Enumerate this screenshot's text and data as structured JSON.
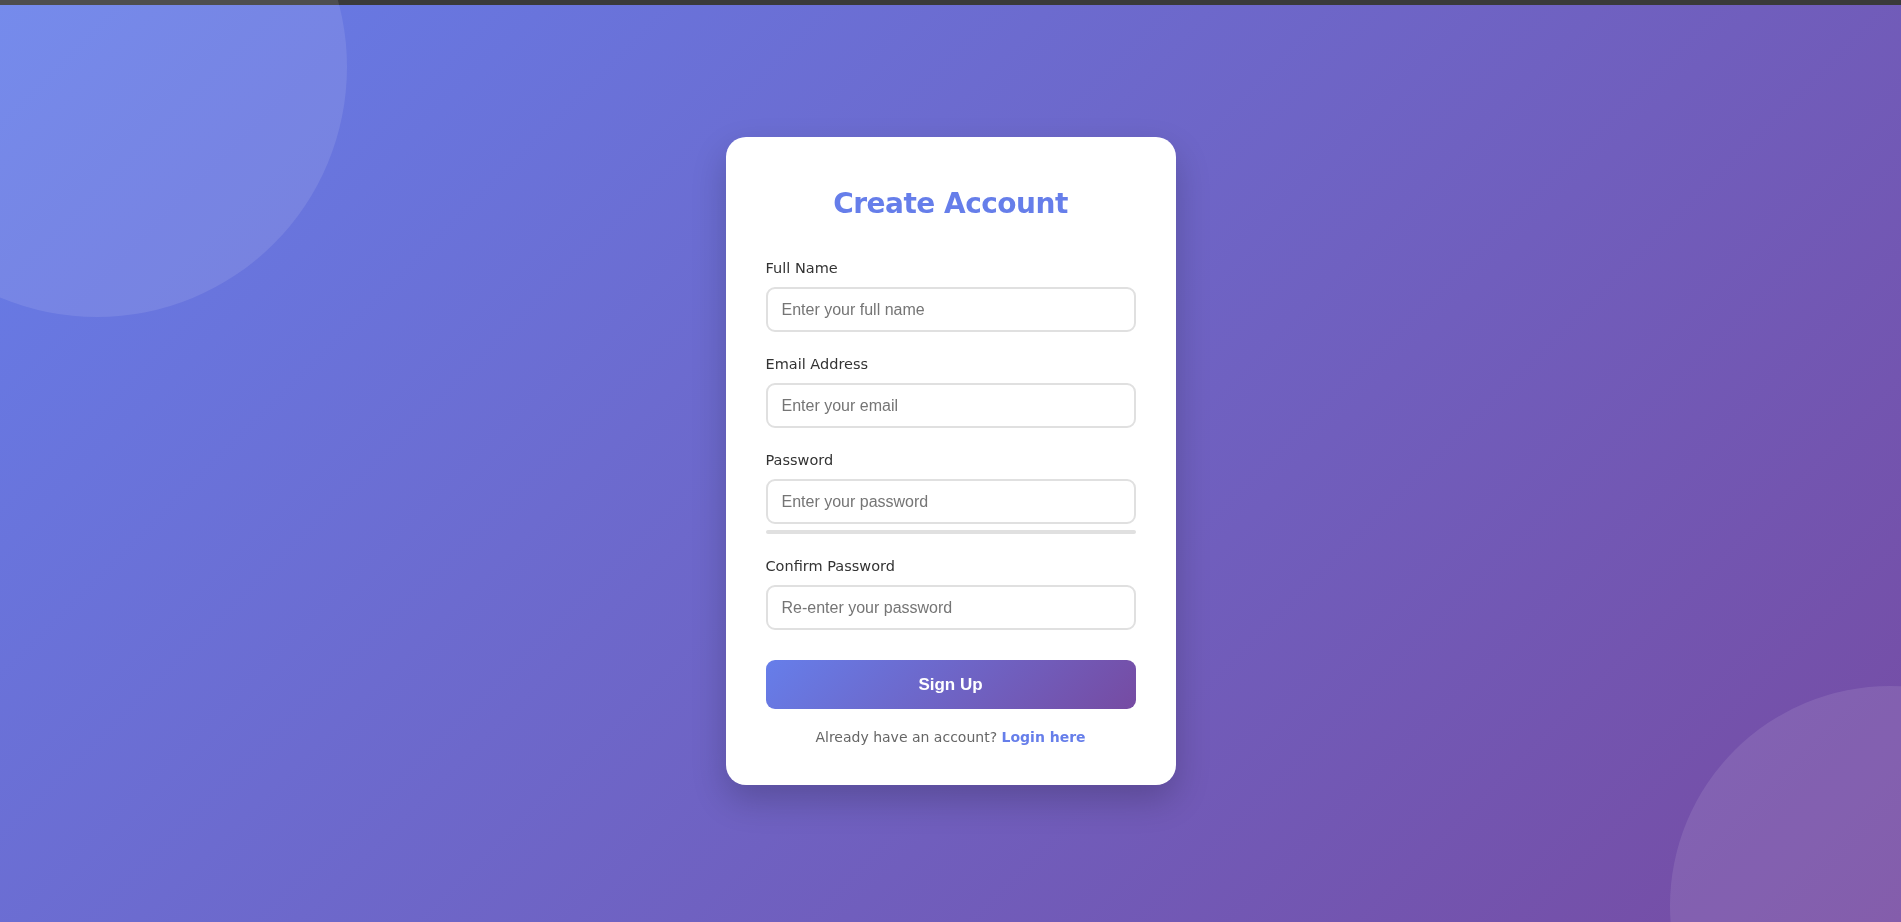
{
  "card": {
    "title": "Create Account",
    "fields": [
      {
        "label": "Full Name",
        "placeholder": "Enter your full name"
      },
      {
        "label": "Email Address",
        "placeholder": "Enter your email"
      },
      {
        "label": "Password",
        "placeholder": "Enter your password",
        "strength_meter": {
          "level": 0
        }
      },
      {
        "label": "Confirm Password",
        "placeholder": "Re-enter your password"
      }
    ],
    "submit_button": "Sign Up",
    "footer": {
      "text": "Already have an account?",
      "link": "Login here"
    }
  }
}
